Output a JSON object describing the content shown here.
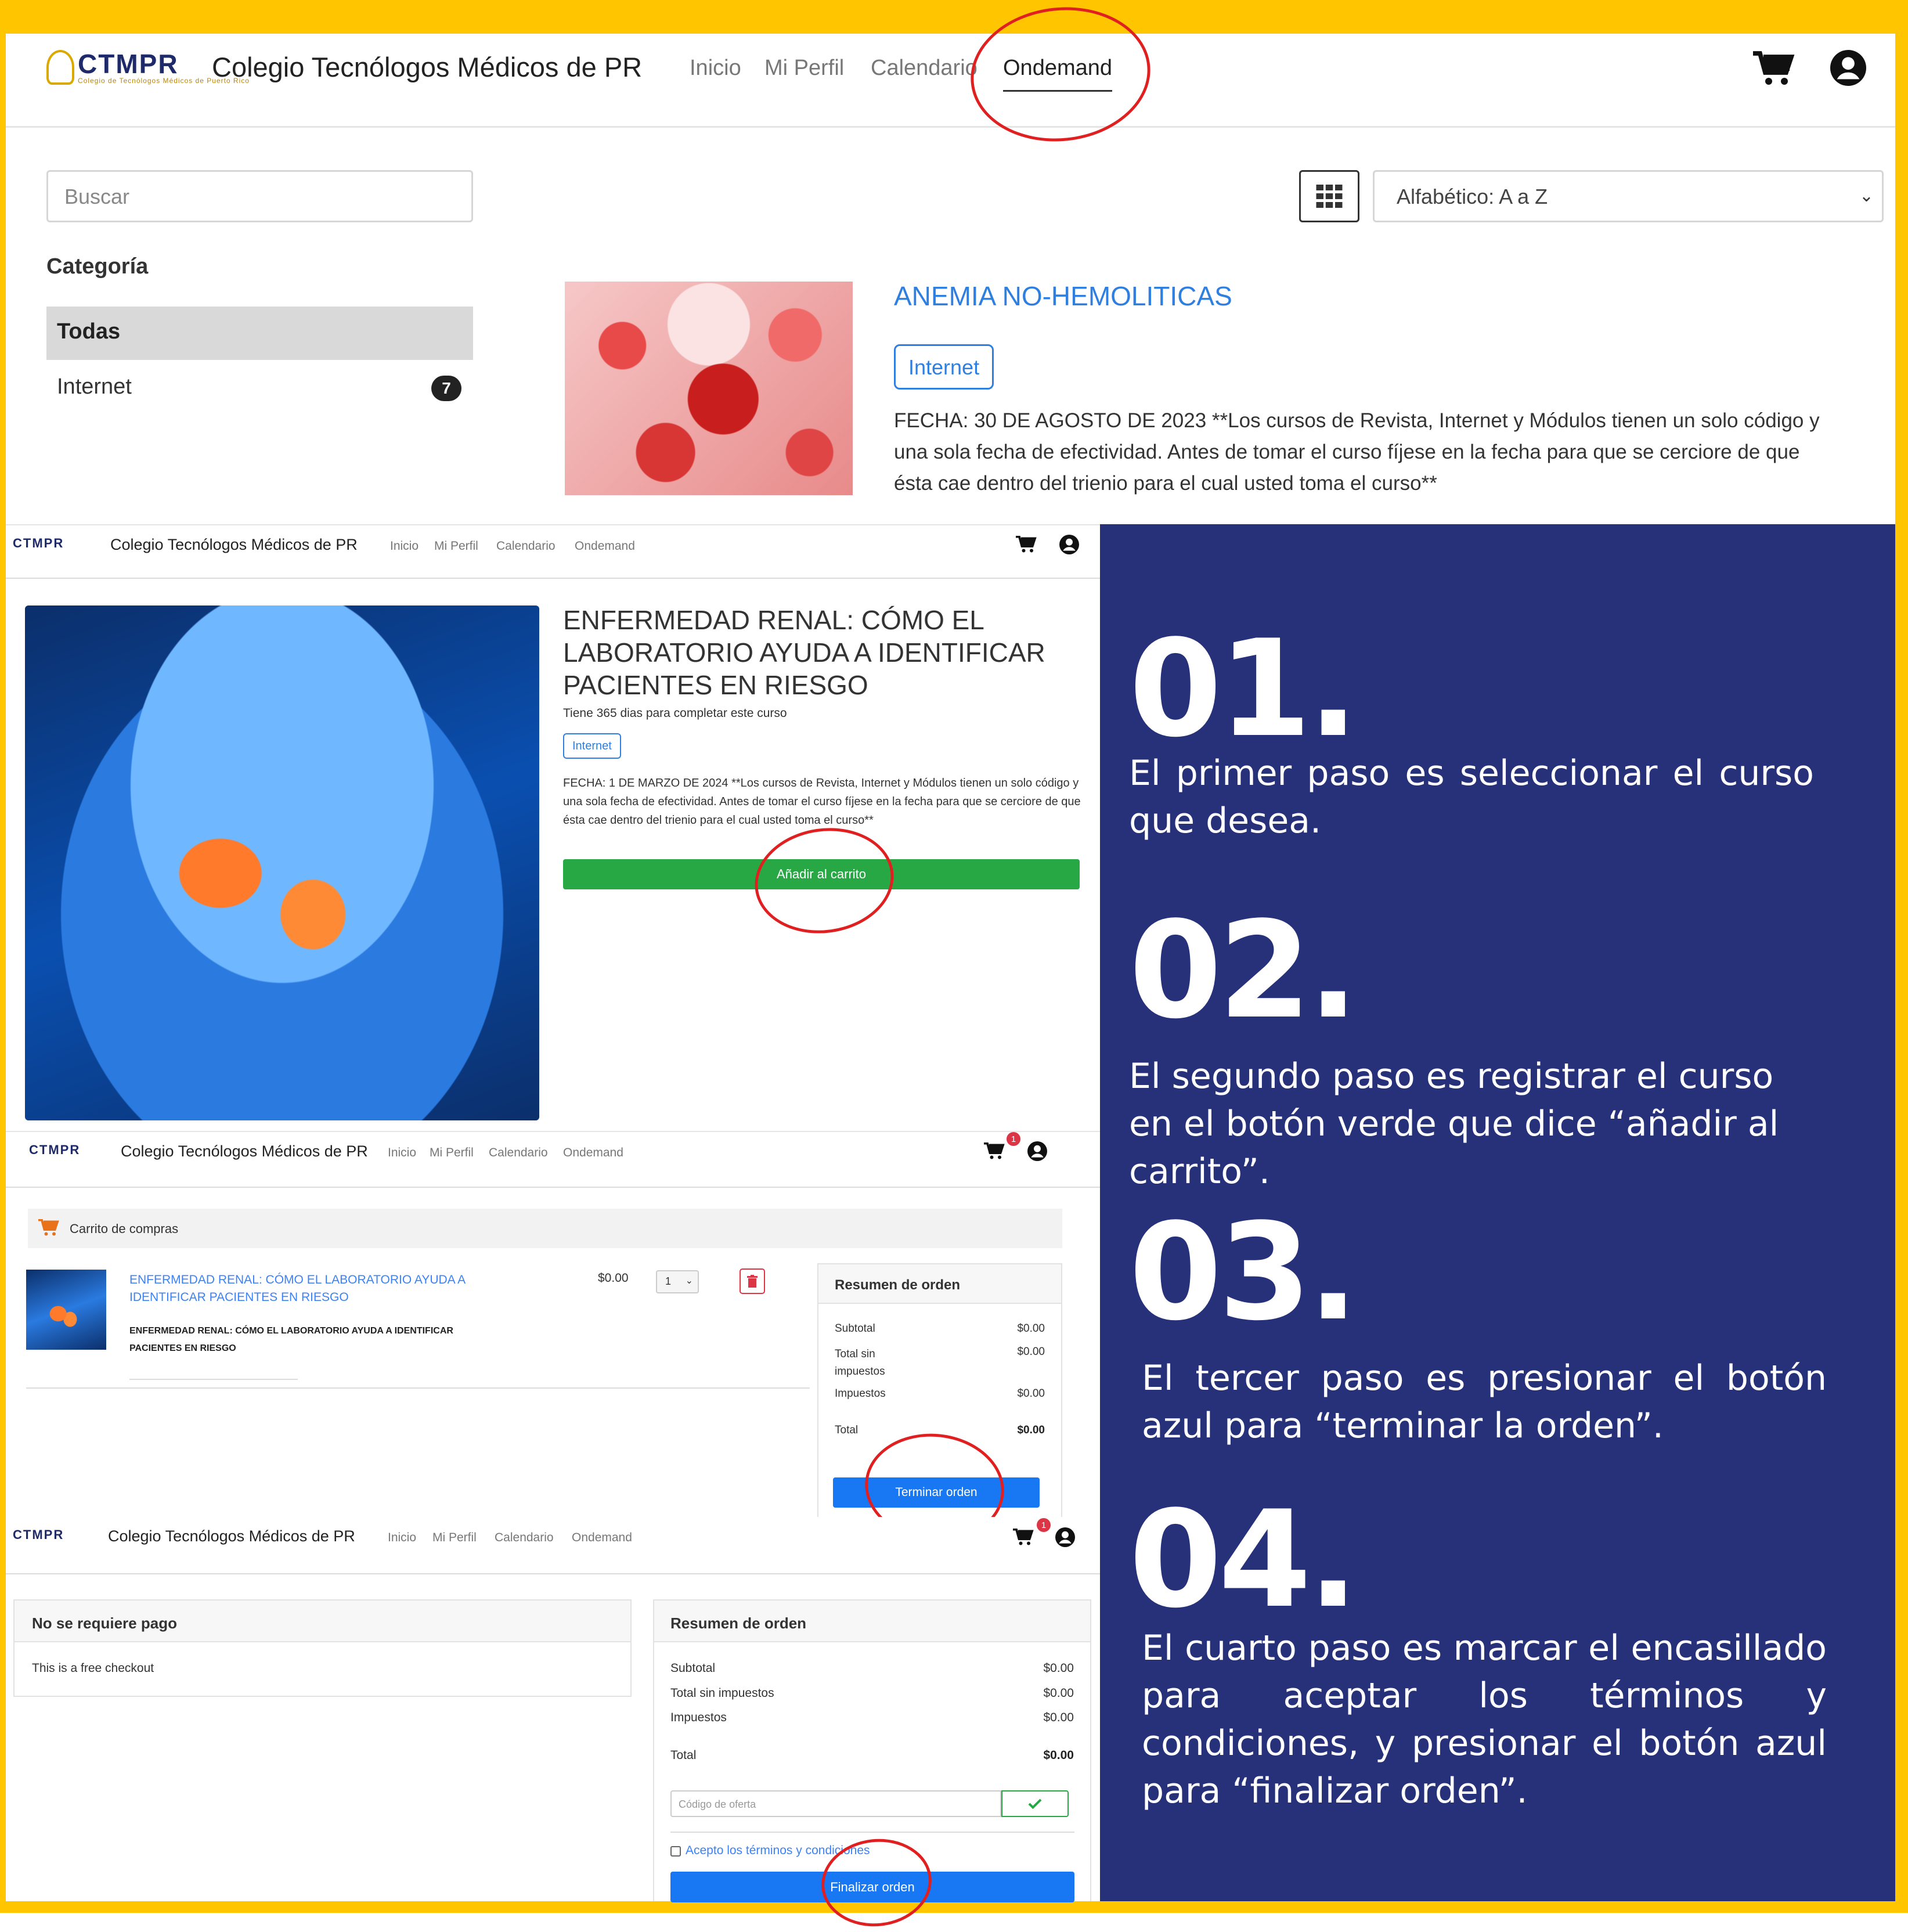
{
  "brand": {
    "logo_text": "CTMPR",
    "logo_subtext": "Colegio de Tecnólogos Médicos de Puerto Rico",
    "site_title": "Colegio Tecnólogos Médicos de PR"
  },
  "nav": {
    "items": [
      "Inicio",
      "Mi Perfil",
      "Calendario",
      "Ondemand"
    ],
    "active": "Ondemand"
  },
  "screen1": {
    "search_placeholder": "Buscar",
    "sort_value": "Alfabético: A a Z",
    "category_heading": "Categoría",
    "categories": [
      {
        "label": "Todas",
        "count": ""
      },
      {
        "label": "Internet",
        "count": "7"
      }
    ],
    "course": {
      "title": "ANEMIA NO-HEMOLITICAS",
      "tag": "Internet",
      "description": "FECHA: 30 DE AGOSTO DE 2023 **Los cursos de Revista, Internet y Módulos tienen un solo código y una sola fecha de efectividad. Antes de tomar el curso fíjese en la fecha para que se cerciore de que ésta cae dentro del trienio para el cual usted toma el curso**"
    }
  },
  "screen2": {
    "title": "ENFERMEDAD RENAL: CÓMO EL LABORATORIO AYUDA A IDENTIFICAR PACIENTES EN RIESGO",
    "days_note": "Tiene 365 dias para completar este curso",
    "tag": "Internet",
    "description": "FECHA: 1 DE MARZO DE 2024 **Los cursos de Revista, Internet y Módulos tienen un solo código y una sola fecha de efectividad. Antes de tomar el curso fíjese en la fecha para que se cerciore de que ésta cae dentro del trienio para el cual usted toma el curso**",
    "add_to_cart": "Añadir al carrito"
  },
  "screen3": {
    "cart_badge": "1",
    "cart_heading": "Carrito de compras",
    "item_link": "ENFERMEDAD RENAL: CÓMO EL LABORATORIO AYUDA A IDENTIFICAR PACIENTES EN RIESGO",
    "item_name": "ENFERMEDAD RENAL: CÓMO EL LABORATORIO AYUDA A IDENTIFICAR PACIENTES EN RIESGO",
    "item_price": "$0.00",
    "item_qty": "1",
    "summary": {
      "heading": "Resumen de orden",
      "subtotal_label": "Subtotal",
      "subtotal": "$0.00",
      "pretax_label": "Total sin impuestos",
      "pretax": "$0.00",
      "tax_label": "Impuestos",
      "tax": "$0.00",
      "total_label": "Total",
      "total": "$0.00"
    },
    "checkout_button": "Terminar orden"
  },
  "screen4": {
    "cart_badge": "1",
    "payment_heading": "No se requiere pago",
    "payment_text": "This is a free checkout",
    "summary": {
      "heading": "Resumen de orden",
      "subtotal_label": "Subtotal",
      "subtotal": "$0.00",
      "pretax_label": "Total sin impuestos",
      "pretax": "$0.00",
      "tax_label": "Impuestos",
      "tax": "$0.00",
      "total_label": "Total",
      "total": "$0.00"
    },
    "coupon_placeholder": "Código de oferta",
    "terms_label": "Acepto los términos y condiciones",
    "finalize_button": "Finalizar orden"
  },
  "steps": [
    {
      "number": "01.",
      "text": "El primer paso es seleccionar el curso que desea."
    },
    {
      "number": "02.",
      "text": "El segundo paso es registrar el curso en el botón verde que dice “añadir al carrito”."
    },
    {
      "number": "03.",
      "text": "El tercer paso es presionar el botón azul para “terminar la orden”."
    },
    {
      "number": "04.",
      "text": "El cuarto paso es marcar el encasillado para aceptar los términos y condiciones, y presionar el botón azul para “finalizar orden”."
    }
  ],
  "colors": {
    "frame_yellow": "#FFC600",
    "panel_navy": "#27317a",
    "green_button": "#28a745",
    "blue_button": "#1877f2",
    "annotation_red": "#e02020"
  },
  "icons": [
    "cart-icon",
    "user-circle-icon",
    "grid-icon",
    "chevron-down-icon",
    "trash-icon",
    "check-icon"
  ]
}
